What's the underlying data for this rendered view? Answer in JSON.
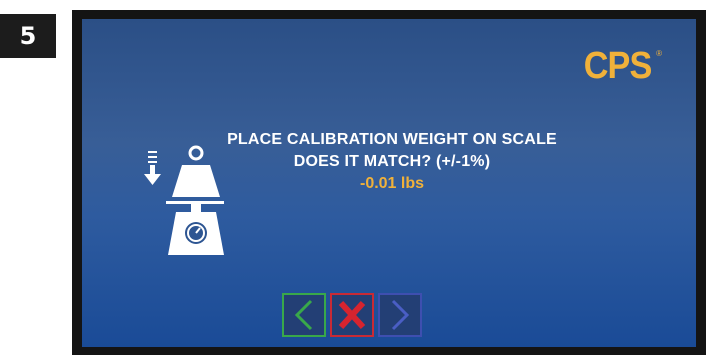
{
  "step": {
    "number": "5"
  },
  "logo": {
    "text": "CPS",
    "registered_mark": "®"
  },
  "message": {
    "line1": "PLACE CALIBRATION WEIGHT ON SCALE",
    "line2": "DOES IT MATCH? (+/-1%)",
    "reading": "-0.01 lbs"
  },
  "icons": {
    "scale": "calibration-scale-icon",
    "down_arrow": "down-arrow-icon",
    "back": "chevron-left-icon",
    "cancel": "x-icon",
    "next": "chevron-right-icon"
  },
  "colors": {
    "accent": "#f0b13a",
    "back_button": "#39a84a",
    "cancel_button": "#c92a35",
    "next_button": "#3e4fb0",
    "screen_top": "#2b4f86",
    "screen_bottom": "#1a4b97"
  }
}
